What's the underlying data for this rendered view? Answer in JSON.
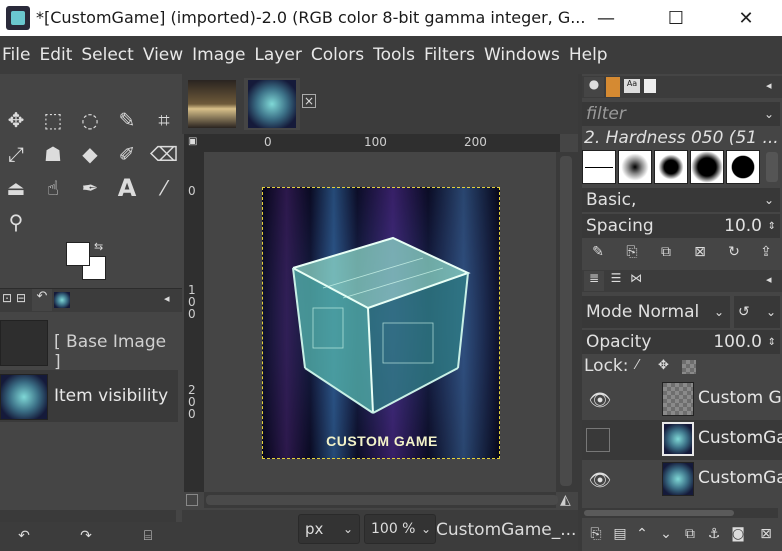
{
  "window": {
    "title": "*[CustomGame] (imported)-2.0 (RGB color 8-bit gamma integer, G...",
    "minimize": "—",
    "maximize": "☐",
    "close": "✕"
  },
  "menu": [
    "File",
    "Edit",
    "Select",
    "View",
    "Image",
    "Layer",
    "Colors",
    "Tools",
    "Filters",
    "Windows",
    "Help"
  ],
  "left_panel": {
    "items": [
      {
        "label": "[ Base Image ]"
      },
      {
        "label": "Item visibility"
      }
    ]
  },
  "canvas": {
    "ruler_top": [
      "0",
      "100",
      "200"
    ],
    "ruler_left": [
      "0",
      "1\n0\n0",
      "2\n0\n0"
    ],
    "image_caption": "CUSTOM GAME"
  },
  "statusbar": {
    "unit": "px",
    "zoom": "100 %",
    "image_name": "CustomGame_..."
  },
  "brushes": {
    "filter_placeholder": "filter",
    "brush_name": "2. Hardness 050 (51 ...",
    "preset": "Basic,",
    "spacing_label": "Spacing",
    "spacing_value": "10.0"
  },
  "layers": {
    "mode": "Mode Normal",
    "opacity_label": "Opacity",
    "opacity_value": "100.0",
    "lock_label": "Lock:",
    "items": [
      {
        "name": "Custom G",
        "visible": true
      },
      {
        "name": "CustomGa",
        "visible": false
      },
      {
        "name": "CustomGa",
        "visible": true
      }
    ]
  }
}
